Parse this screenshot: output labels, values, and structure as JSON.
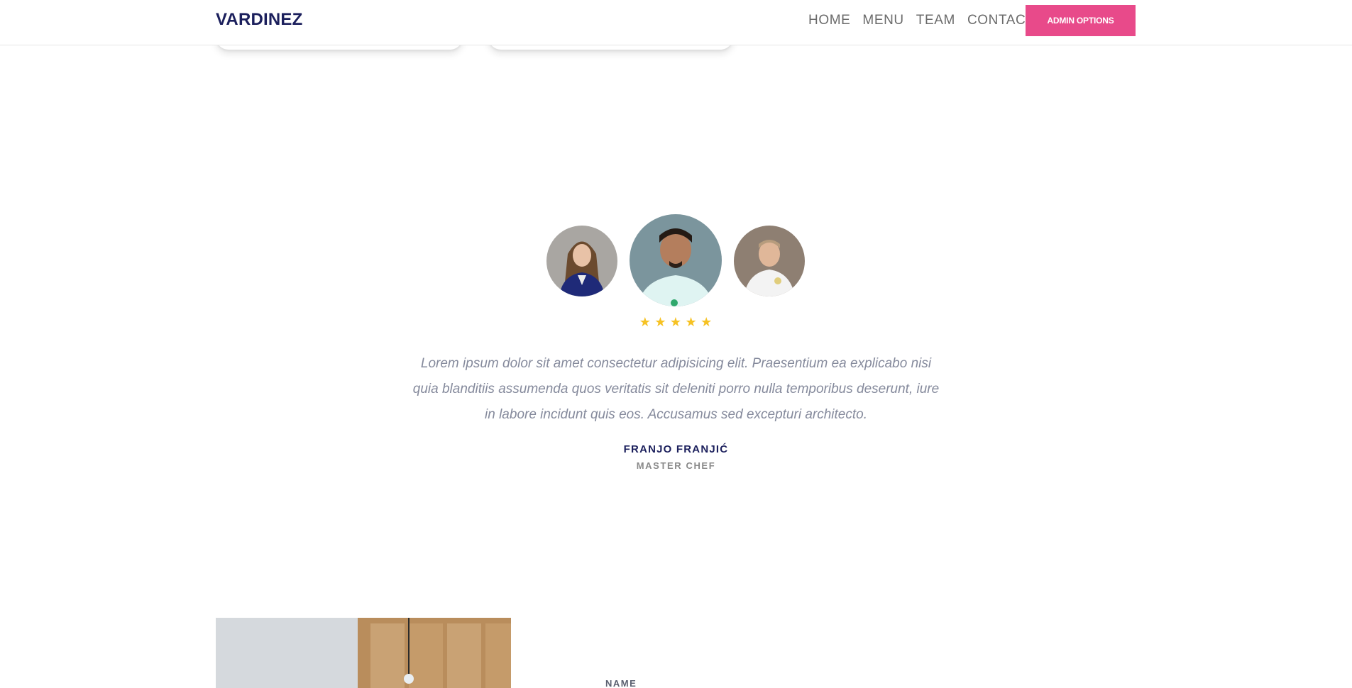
{
  "header": {
    "brand": "VARDINEZ",
    "nav": [
      {
        "label": "HOME"
      },
      {
        "label": "MENU"
      },
      {
        "label": "TEAM"
      },
      {
        "label": "CONTACT"
      }
    ],
    "admin_button": "ADMIN OPTIONS",
    "accent_color": "#e84a8a"
  },
  "testimonial": {
    "rating": 5,
    "stars": [
      "★",
      "★",
      "★",
      "★",
      "★"
    ],
    "quote": "Lorem ipsum dolor sit amet consectetur adipisicing elit. Praesentium ea explicabo nisi quia blanditiis assumenda quos veritatis sit deleniti porro nulla temporibus deserunt, iure in labore incidunt quis eos. Accusamus sed excepturi architecto.",
    "author": "FRANJO FRANJIĆ",
    "role": "MASTER CHEF",
    "star_color": "#f6c224"
  },
  "form": {
    "name_label": "NAME"
  }
}
